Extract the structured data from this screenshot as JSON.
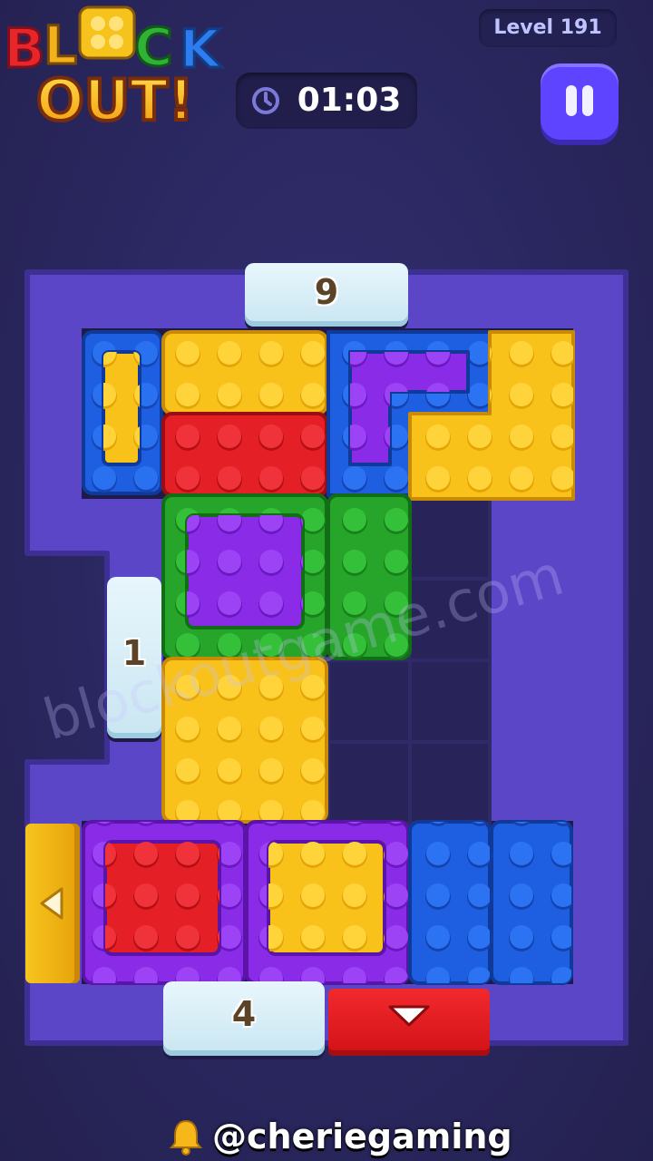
{
  "header": {
    "logo_line1": "BLOCK",
    "logo_line2": "OUT!",
    "level_label": "Level 191",
    "timer_value": "01:03"
  },
  "gates": {
    "top": "9",
    "left": "1",
    "bottom": "4"
  },
  "watermark": "blockoutgame.com",
  "footer": {
    "handle": "@cheriegaming"
  },
  "colors": {
    "background": "#2b285e",
    "board": "#5a46c6",
    "yellow": "#f8c21a",
    "red": "#e51f26",
    "blue": "#1d5fe0",
    "green": "#26a52a",
    "purple": "#8a2be8",
    "gate_ice": "#d9eff8",
    "exit_yellow": "#f5b815",
    "exit_red": "#e51f26",
    "pause_button": "#5e44ff"
  },
  "icons": {
    "clock": "clock-icon",
    "pause": "pause-icon",
    "exit_left_arrow": "arrow-left-icon",
    "exit_down_arrow": "arrow-down-icon",
    "bell": "bell-icon"
  }
}
